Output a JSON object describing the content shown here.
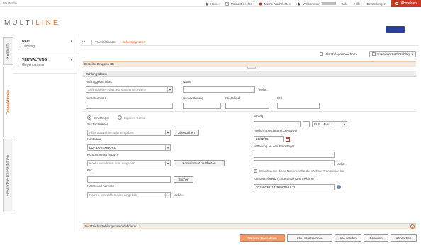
{
  "topbar": {
    "profile": "My Profile",
    "nav": [
      {
        "label": "Home",
        "icon": "home-icon"
      },
      {
        "label": "Meine Berichte",
        "icon": "report-icon"
      },
      {
        "label": "Meine Nachrichten",
        "icon": "mail-icon"
      },
      {
        "label": "Willkommen",
        "icon": "user-icon"
      },
      {
        "label": "Info",
        "icon": "info-icon"
      },
      {
        "label": "Hilfe",
        "icon": "help-icon"
      },
      {
        "label": "Einstellungen",
        "icon": "settings-icon"
      }
    ],
    "logout": "Abmelden"
  },
  "logo": {
    "part1": "MULTI",
    "part2": "LINE"
  },
  "action_button": "",
  "vertical_tabs": [
    "Kontoinfo",
    "Transaktionen",
    "Gesendete Transaktionen"
  ],
  "left_menu": [
    {
      "title": "NEU",
      "subtitle": "Zahlung"
    },
    {
      "title": "VERWALTUNG",
      "subtitle": "Gegenparteien"
    }
  ],
  "breadcrumb": {
    "items": [
      "Transaktionen",
      "Zahlungsgruppe"
    ]
  },
  "template": {
    "checkbox_label": "Als Vorlage speichern",
    "favorite_button": "Zuweisen zu Einschlag"
  },
  "sections": {
    "created_groups": "Erstellte Gruppen (0)",
    "payment_data": "Zahlungsdaten",
    "additional": "Zusätzliche Zahlungsdaten definieren"
  },
  "ordering": {
    "alias_label": "Auftraggeber Alias",
    "alias_placeholder": "Auftraggeber-Alias, Kontonummer, Name",
    "name_label": "Name",
    "more": "Mehr...",
    "account_label": "Kontonummer",
    "currency_label": "Kontowährung",
    "country_label": "Kontoland",
    "bic_label": "BIC"
  },
  "beneficiary": {
    "radio_recipient": "Empfänger",
    "radio_own": "Eigenes Konto",
    "search_key_label": "Suchschlüssel",
    "search_key_placeholder": "Alias auswählen oder eingeben",
    "search_all_button": "Alle suchen",
    "country_label": "Kontoland",
    "country_value": "LU - LUXEMBURG",
    "iban_label": "Kontonummer (IBAN)",
    "iban_placeholder": "Konto auswählen oder eingeben",
    "format_button": "Kontoformat bearbeiten",
    "bic_label": "BIC",
    "search_button": "Suchen",
    "name_label": "Name und Adresse",
    "name_placeholder": "Namen auswählen oder eingeben",
    "more": "Mehr..."
  },
  "payment": {
    "amount_label": "Betrag",
    "currency_value": "EUR - Euro",
    "exec_date_label": "Ausführungsdatum (JJ/MM/yy)",
    "exec_date_value": "20/02/15",
    "message_label": "Mitteilung an den Empfänger",
    "more": "Mehr...",
    "keep_message_label": "Behalten Sie diese Nachricht für die nächste Transaktion bei",
    "customer_ref_label": "Kundenreferenz (Ende Ende Kennzeichner)",
    "customer_ref_value": "20150220114253500MULTI"
  },
  "footer_buttons": [
    "Nächste Transaktion",
    "Alle unterzeichnen",
    "Alle senden",
    "Beenden",
    "Abbrechen"
  ],
  "colors": {
    "accent": "#e06a1f",
    "logout": "#c43a24",
    "primary_button": "#f19a67",
    "blue_button": "#2d3f9e"
  }
}
